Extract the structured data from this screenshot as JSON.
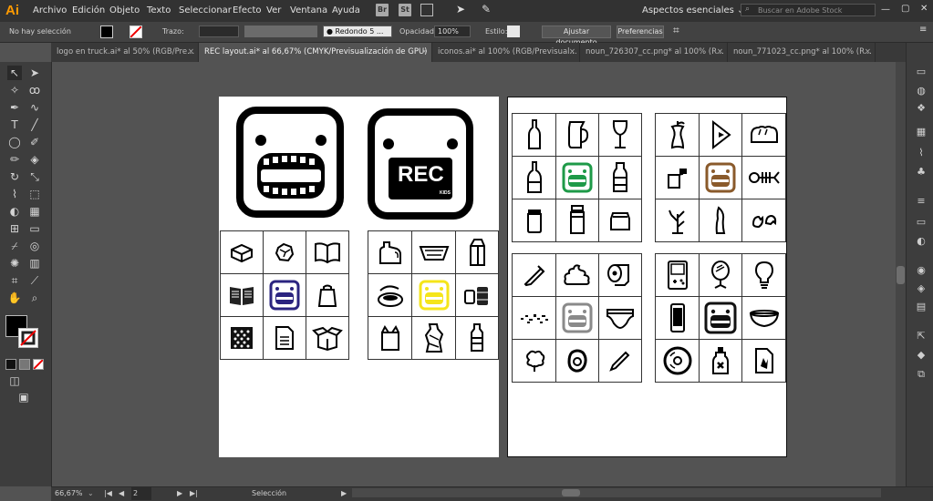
{
  "app": {
    "logo": "Ai"
  },
  "menus": [
    "Archivo",
    "Edición",
    "Objeto",
    "Texto",
    "Seleccionar",
    "Efecto",
    "Ver",
    "Ventana",
    "Ayuda"
  ],
  "bridge_badges": [
    "Br",
    "St"
  ],
  "workspace": {
    "label": "Aspectos esenciales",
    "stock_placeholder": "Buscar en Adobe Stock"
  },
  "control": {
    "selection_state": "No hay selección",
    "stroke_label": "Trazo:",
    "brush_label": "Redondo 5 ...",
    "opacity_label": "Opacidad:",
    "opacity_value": "100%",
    "style_label": "Estilo:",
    "fit_doc_button": "Ajustar documento",
    "prefs_button": "Preferencias"
  },
  "tabs": [
    {
      "label": "logo en truck.ai* al 50% (RGB/Pre...",
      "active": false
    },
    {
      "label": "REC layout.ai* al 66,67% (CMYK/Previsualización de GPU)",
      "active": true
    },
    {
      "label": "iconos.ai* al 100% (RGB/Previsual...",
      "active": false
    },
    {
      "label": "noun_726307_cc.png* al 100% (R...",
      "active": false
    },
    {
      "label": "noun_771023_cc.png* al 100% (R...",
      "active": false
    }
  ],
  "status": {
    "zoom": "66,67%",
    "artboard": "2",
    "tool": "Selección"
  },
  "artboards": {
    "left": {
      "logo_badge_text": "REC",
      "logo_badge_sub": "KIDS",
      "grid_a_accent": "#2b2480",
      "grid_b_accent": "#f5e51a"
    },
    "right": {
      "grid_a_accent": "#1e9a48",
      "grid_b_accent": "#8a5a2b",
      "grid_c_accent": "#8a8a8a",
      "grid_d_accent": "#111111"
    }
  },
  "colors": {
    "menubar": "#323232",
    "canvas": "#535353",
    "panel": "#3d3d3d",
    "brand": "#ff9a00"
  }
}
